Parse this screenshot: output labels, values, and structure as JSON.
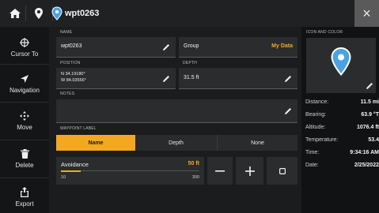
{
  "header": {
    "title": "wpt0263",
    "close_symbol": "×"
  },
  "sidebar": {
    "items": [
      {
        "label": "Cursor To",
        "icon": "crosshair-icon"
      },
      {
        "label": "Navigation",
        "icon": "navigation-arrow-icon"
      },
      {
        "label": "Move",
        "icon": "move-arrows-icon"
      },
      {
        "label": "Delete",
        "icon": "trash-icon"
      },
      {
        "label": "Export",
        "icon": "export-icon"
      }
    ]
  },
  "form": {
    "name_label": "NAME",
    "name_value": "wpt0263",
    "group_label": "Group",
    "group_value": "My Data",
    "position_label": "POSITION",
    "position_lat": "N 34.19180°",
    "position_lon": "W 84.03556°",
    "depth_label": "DEPTH",
    "depth_value": "31.5 ft",
    "notes_label": "NOTES",
    "notes_value": "",
    "waypoint_label_title": "WAYPOINT LABEL",
    "label_options": [
      "Name",
      "Depth",
      "None"
    ],
    "selected_label_option": "Name",
    "avoidance_label": "Avoidance",
    "avoidance_value": "50 ft",
    "avoidance_min": "10",
    "avoidance_max": "300",
    "avoidance_level": 0.14
  },
  "icon_panel": {
    "title": "ICON AND COLOR",
    "icon": "waypoint-pin-icon",
    "color": "#4aa3e0"
  },
  "info": {
    "rows": [
      {
        "key": "Distance:",
        "value": "11.5 mi"
      },
      {
        "key": "Bearing:",
        "value": "63.9 °T"
      },
      {
        "key": "Altitude:",
        "value": "1076.4 ft"
      },
      {
        "key": "Temperature:",
        "value": "53.4"
      },
      {
        "key": "Time:",
        "value": "9:34:16 AM"
      },
      {
        "key": "Date:",
        "value": "2/25/2022"
      }
    ]
  },
  "colors": {
    "accent": "#f4a81f",
    "pin": "#4aa3e0",
    "background": "#1b1c1e"
  }
}
